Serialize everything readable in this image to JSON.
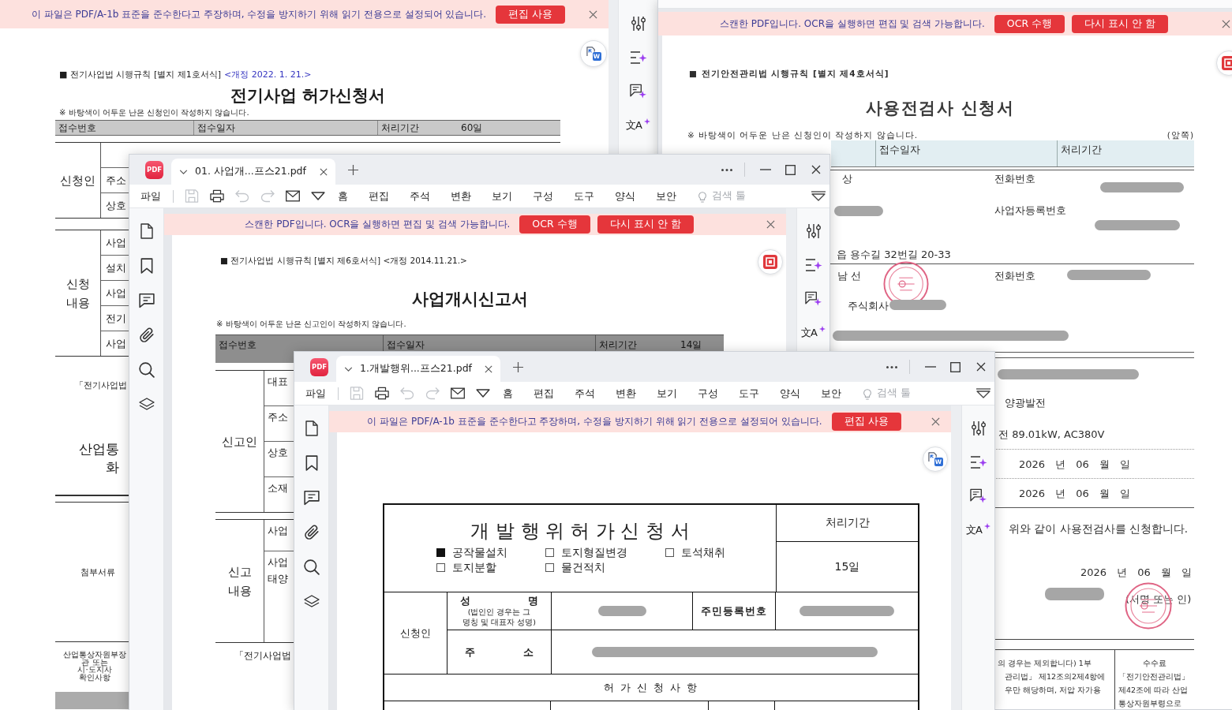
{
  "windows": [
    {
      "banner": {
        "message": "이 파일은 PDF/A-1b 표준을 준수한다고 주장하며, 수정을 방지하기 위해 읽기 전용으로 설정되어 있습니다.",
        "buttons": [
          "편집 사용"
        ]
      },
      "float_button": {
        "kind": "word",
        "badge": "W"
      },
      "tools": [
        {
          "kind": "sliders"
        },
        {
          "kind": "list-sparkle"
        },
        {
          "kind": "comment-sparkle"
        },
        {
          "kind": "translate",
          "glyph": "文A"
        }
      ],
      "document": {
        "kind": "permit",
        "header": "■ 전기사업법 시행규칙 [별지 제1호서식]",
        "amendment": "<개정 2022. 1. 21.>",
        "title": "전기사업 허가신청서",
        "notice": "※ 바탕색이 어두운 난은 신청인이 작성하지 않습니다.",
        "intake": [
          {
            "label": "접수번호"
          },
          {
            "label": "접수일자"
          },
          {
            "label": "처리기간",
            "value": "60일"
          }
        ],
        "sections": [
          {
            "label": "신청인",
            "rows": [
              {
                "labels": [
                  "주소"
                ]
              },
              {
                "labels": [
                  "상호"
                ]
              }
            ]
          },
          {
            "label": "신청 내용",
            "rows": [
              {
                "labels": [
                  "사업"
                ]
              },
              {
                "labels": [
                  "설치"
                ]
              },
              {
                "labels": [
                  "사업"
                ]
              },
              {
                "labels": [
                  "전기"
                ]
              },
              {
                "labels": [
                  "사업"
                ]
              }
            ]
          }
        ],
        "declaration": "「전기사업법",
        "addressee": [
          "산업통",
          "화"
        ],
        "attachments_label": "첨부서류",
        "verification_label": "산업통상자원부장\n관 또는\n시·도지사\n확인사항"
      }
    },
    {
      "banner": {
        "message": "스캔한 PDF입니다. OCR을 실행하면 편집 및 검색 가능합니다.",
        "buttons": [
          "OCR 수행",
          "다시 표시 안 함"
        ]
      },
      "float_button": {
        "kind": "ocr"
      },
      "document": {
        "kind": "inspection",
        "header": "■ 전기안전관리법 시행규칙 [별지 제4호서식]",
        "title": "사용전검사 신청서",
        "notice": "※ 바탕색이 어두운 난은 신청인이 작성하지 않습니다.",
        "page_side": "(앞쪽)",
        "intake": [
          {
            "label": "접수일자"
          },
          {
            "label": "처리기간"
          }
        ],
        "applicant_rows": [
          {
            "cells": [
              {
                "text": "상"
              },
              {
                "text": "전화번호"
              },
              {
                "redacted": true
              }
            ]
          },
          {
            "cells": [
              {
                "redacted": true
              },
              {
                "text": "사업자등록번호"
              },
              {
                "redacted": true
              }
            ]
          },
          {
            "cells": [
              {
                "text": "읍 용수길 32번길 20-33"
              }
            ]
          }
        ],
        "manager_rows": [
          {
            "cells": [
              {
                "text": "남 선",
                "stamped": true
              },
              {
                "text": "전화번호"
              },
              {
                "redacted": true
              }
            ]
          },
          {
            "cells": [
              {
                "text": "주식회사",
                "redacted": true
              }
            ]
          },
          {
            "cells": [
              {
                "redacted": true
              }
            ]
          }
        ],
        "facility_rows": [
          {
            "redacted": true
          },
          {
            "text": "양광발전"
          },
          {
            "text": "전 89.01kW, AC380V"
          },
          {
            "text": "2026 년 06 월 일"
          },
          {
            "text": "2026 년 06 월 일"
          }
        ],
        "statement": "위와 같이 사용전검사를 신청합니다.",
        "signed_date": "2026 년 06 월 일",
        "signer": {
          "redacted": true,
          "hint": "(서명 또는 인)",
          "stamped": true
        },
        "footer_lines": [
          "의 경우는 제외합니다) 1부",
          "관리법」 제12조의2제4항에",
          "우만 해당하며, 저압 자가용"
        ],
        "fee": {
          "title": "수수료",
          "text": "「전기안전관리법」\n제42조에 따라 산업\n통상자원부령으로"
        }
      }
    },
    {
      "logo": "PDF",
      "tabs": [
        {
          "title": "01. 사업개...프스21.pdf",
          "selected": true
        }
      ],
      "file_menu": "파일",
      "quick_actions": [
        {
          "kind": "save",
          "disabled": true
        },
        {
          "kind": "print",
          "disabled": false
        },
        {
          "kind": "undo",
          "disabled": true
        },
        {
          "kind": "redo",
          "disabled": true
        },
        {
          "kind": "mail",
          "disabled": false
        },
        {
          "kind": "caret",
          "disabled": false
        }
      ],
      "menus": [
        "홈",
        "편집",
        "주석",
        "변환",
        "보기",
        "구성",
        "도구",
        "양식",
        "보안"
      ],
      "search_tools": "검색 툴",
      "sidebar": [
        {
          "kind": "page"
        },
        {
          "kind": "bookmark"
        },
        {
          "kind": "comment"
        },
        {
          "kind": "attachment"
        },
        {
          "kind": "search"
        },
        {
          "kind": "layers"
        }
      ],
      "banner": {
        "message": "스캔한 PDF입니다. OCR을 실행하면 편집 및 검색 가능합니다.",
        "buttons": [
          "OCR 수행",
          "다시 표시 안 함"
        ]
      },
      "float_button": {
        "kind": "ocr"
      },
      "tools": [
        {
          "kind": "sliders"
        },
        {
          "kind": "list-sparkle"
        },
        {
          "kind": "comment-sparkle"
        },
        {
          "kind": "translate",
          "glyph": "文A"
        }
      ],
      "document": {
        "kind": "opening",
        "header": "■ 전기사업법 시행규칙 [별지 제6호서식] <개정 2014.11.21.>",
        "title": "사업개시신고서",
        "notice": "※ 바탕색이 어두운 난은 신고인이 작성하지 않습니다.",
        "intake": [
          {
            "label": "접수번호"
          },
          {
            "label": "접수일자"
          },
          {
            "label": "처리기간",
            "value": "14일"
          }
        ],
        "sections": [
          {
            "label": "신고인",
            "rows": [
              {
                "labels": [
                  "대표"
                ]
              },
              {
                "labels": [
                  "주소"
                ]
              },
              {
                "labels": [
                  "상호"
                ]
              },
              {
                "labels": [
                  "소재"
                ]
              }
            ]
          },
          {
            "label": "신고 내용",
            "rows": [
              {
                "labels": [
                  "사업"
                ]
              },
              {
                "labels": [
                  "사업",
                  "태양"
                ]
              }
            ]
          }
        ],
        "declaration": "「전기사업법"
      }
    },
    {
      "logo": "PDF",
      "tabs": [
        {
          "title": "1.개발행위...프스21.pdf",
          "selected": true
        }
      ],
      "file_menu": "파일",
      "quick_actions": [
        {
          "kind": "save",
          "disabled": true
        },
        {
          "kind": "print",
          "disabled": false
        },
        {
          "kind": "undo",
          "disabled": true
        },
        {
          "kind": "redo",
          "disabled": true
        },
        {
          "kind": "mail",
          "disabled": false
        },
        {
          "kind": "caret",
          "disabled": false
        }
      ],
      "menus": [
        "홈",
        "편집",
        "주석",
        "변환",
        "보기",
        "구성",
        "도구",
        "양식",
        "보안"
      ],
      "search_tools": "검색 툴",
      "sidebar": [
        {
          "kind": "page"
        },
        {
          "kind": "bookmark"
        },
        {
          "kind": "comment"
        },
        {
          "kind": "attachment"
        },
        {
          "kind": "search"
        },
        {
          "kind": "layers"
        }
      ],
      "banner": {
        "message": "이 파일은 PDF/A-1b 표준을 준수한다고 주장하며, 수정을 방지하기 위해 읽기 전용으로 설정되어 있습니다.",
        "buttons": [
          "편집 사용"
        ]
      },
      "float_button": {
        "kind": "word",
        "badge": "W"
      },
      "tools": [
        {
          "kind": "sliders"
        },
        {
          "kind": "list-sparkle"
        },
        {
          "kind": "comment-sparkle"
        },
        {
          "kind": "translate",
          "glyph": "文A"
        }
      ],
      "document": {
        "kind": "development",
        "title": "개 발 행 위 허 가 신 청 서",
        "purposes": [
          {
            "label": "공작물설치",
            "checked": true
          },
          {
            "label": "토지형질변경",
            "checked": false
          },
          {
            "label": "토석채취",
            "checked": false
          },
          {
            "label": "토지분할",
            "checked": false
          },
          {
            "label": "물건적치",
            "checked": false
          }
        ],
        "period_label": "처리기간",
        "period": "15일",
        "applicant_label": "신청인",
        "name_label": "성 명",
        "name_hint": "(법인인 경우는 그 명칭 및 대표자 성명)",
        "name_redacted": true,
        "id_label": "주민등록번호",
        "id_redacted": true,
        "address_label": "주 소",
        "address_redacted": true,
        "section_title": "허 가 신 청 사 항"
      }
    }
  ]
}
